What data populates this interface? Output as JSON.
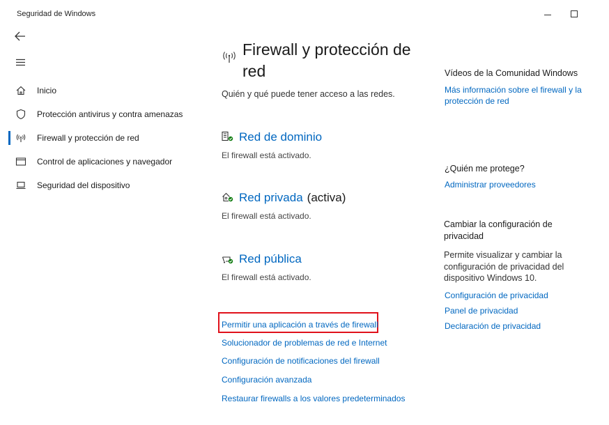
{
  "window": {
    "title": "Seguridad de Windows",
    "minimize_icon": "minimize-icon",
    "maximize_icon": "maximize-icon"
  },
  "nav": {
    "back_icon": "back-arrow-icon",
    "menu_icon": "hamburger-menu-icon",
    "items": [
      {
        "label": "Inicio",
        "icon": "home-icon"
      },
      {
        "label": "Protección antivirus y contra amenazas",
        "icon": "shield-icon"
      },
      {
        "label": "Firewall y protección de red",
        "icon": "wifi-antenna-icon",
        "active": true
      },
      {
        "label": "Control de aplicaciones y navegador",
        "icon": "browser-window-icon"
      },
      {
        "label": "Seguridad del dispositivo",
        "icon": "laptop-icon"
      }
    ]
  },
  "main": {
    "title": "Firewall y protección de red",
    "description": "Quién y qué puede tener acceso a las redes.",
    "networks": [
      {
        "name": "Red de dominio",
        "active_label": "",
        "status": "El firewall está activado.",
        "icon": "domain-network-icon"
      },
      {
        "name": "Red privada",
        "active_label": "(activa)",
        "status": "El firewall está activado.",
        "icon": "private-network-icon"
      },
      {
        "name": "Red pública",
        "active_label": "",
        "status": "El firewall está activado.",
        "icon": "public-network-icon"
      }
    ],
    "links": [
      "Permitir una aplicación a través de firewall",
      "Solucionador de problemas de red e Internet",
      "Configuración de notificaciones del firewall",
      "Configuración avanzada",
      "Restaurar firewalls a los valores predeterminados"
    ]
  },
  "side": {
    "community_heading": "Vídeos de la Comunidad Windows",
    "community_link": "Más información sobre el firewall y la protección de red",
    "protect_heading": "¿Quién me protege?",
    "protect_link": "Administrar proveedores",
    "privacy_heading": "Cambiar la configuración de privacidad",
    "privacy_text": "Permite visualizar y cambiar la configuración de privacidad del dispositivo Windows 10.",
    "privacy_links": [
      "Configuración de privacidad",
      "Panel de privacidad",
      "Declaración de privacidad"
    ]
  },
  "colors": {
    "accent": "#0067c0",
    "status_ok": "#107c10",
    "highlight_border": "#e0111b"
  }
}
